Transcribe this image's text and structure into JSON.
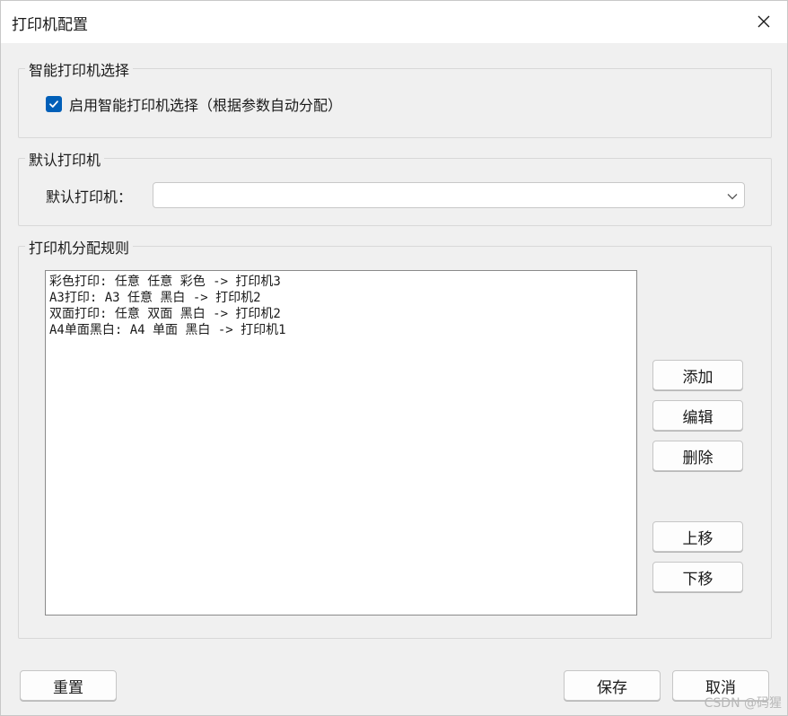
{
  "window": {
    "title": "打印机配置",
    "close_icon": "close-icon"
  },
  "smart_group": {
    "title": "智能打印机选择",
    "checkbox_label": "启用智能打印机选择（根据参数自动分配）",
    "checked": true,
    "accent_color": "#005fb8"
  },
  "default_group": {
    "title": "默认打印机",
    "field_label": "默认打印机：",
    "selected_value": "",
    "dropdown_icon": "chevron-down-icon"
  },
  "rules_group": {
    "title": "打印机分配规则",
    "items": [
      "彩色打印: 任意 任意 彩色 -> 打印机3",
      "A3打印: A3 任意 黑白 -> 打印机2",
      "双面打印: 任意 双面 黑白 -> 打印机2",
      "A4单面黑白: A4 单面 黑白 -> 打印机1"
    ],
    "buttons": {
      "add": "添加",
      "edit": "编辑",
      "delete": "删除",
      "move_up": "上移",
      "move_down": "下移"
    }
  },
  "footer": {
    "reset": "重置",
    "save": "保存",
    "cancel": "取消"
  },
  "watermark": "CSDN @码猩"
}
